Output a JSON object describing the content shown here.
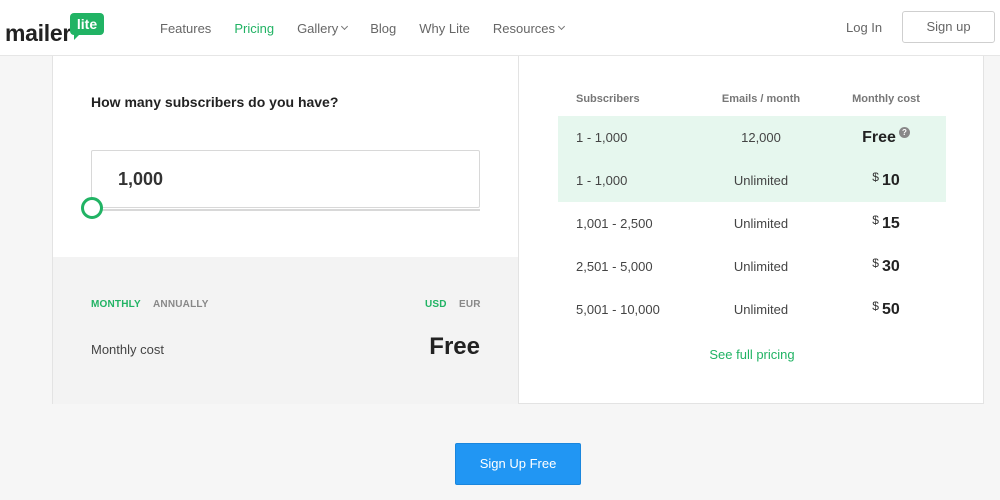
{
  "header": {
    "logo_text": "mailer",
    "logo_badge": "lite",
    "nav": [
      {
        "label": "Features",
        "active": false,
        "dropdown": false
      },
      {
        "label": "Pricing",
        "active": true,
        "dropdown": false
      },
      {
        "label": "Gallery",
        "active": false,
        "dropdown": true
      },
      {
        "label": "Blog",
        "active": false,
        "dropdown": false
      },
      {
        "label": "Why Lite",
        "active": false,
        "dropdown": false
      },
      {
        "label": "Resources",
        "active": false,
        "dropdown": true
      }
    ],
    "login_label": "Log In",
    "signup_label": "Sign up"
  },
  "calculator": {
    "question": "How many subscribers do you have?",
    "subscribers_value": "1,000",
    "billing_monthly": "MONTHLY",
    "billing_annually": "ANNUALLY",
    "currency_usd": "USD",
    "currency_eur": "EUR",
    "cost_label": "Monthly cost",
    "cost_value": "Free"
  },
  "pricing_table": {
    "headers": {
      "subscribers": "Subscribers",
      "emails": "Emails / month",
      "cost": "Monthly cost"
    },
    "rows": [
      {
        "subscribers": "1 - 1,000",
        "emails": "12,000",
        "currency": "",
        "amount": "Free",
        "help": "?"
      },
      {
        "subscribers": "1 - 1,000",
        "emails": "Unlimited",
        "currency": "$",
        "amount": "10"
      },
      {
        "subscribers": "1,001 - 2,500",
        "emails": "Unlimited",
        "currency": "$",
        "amount": "15"
      },
      {
        "subscribers": "2,501 - 5,000",
        "emails": "Unlimited",
        "currency": "$",
        "amount": "30"
      },
      {
        "subscribers": "5,001 - 10,000",
        "emails": "Unlimited",
        "currency": "$",
        "amount": "50"
      }
    ],
    "full_pricing_link": "See full pricing"
  },
  "cta_label": "Sign Up Free",
  "colors": {
    "brand_green": "#21b364",
    "cta_blue": "#2196f3",
    "highlight_row": "#e6f7ee"
  }
}
